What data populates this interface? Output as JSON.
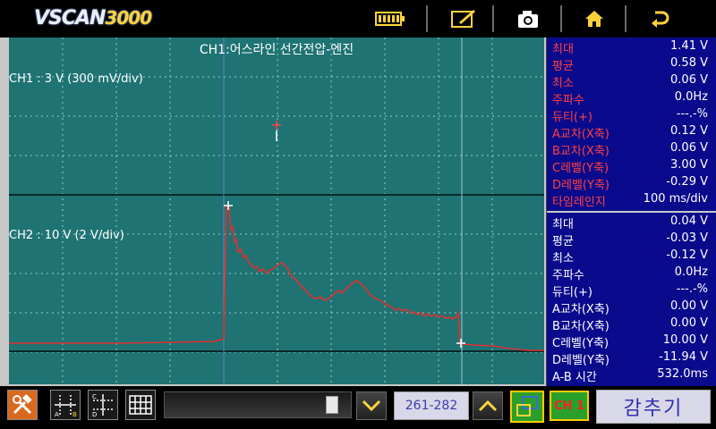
{
  "topbar": {
    "logo_main": "VSCAN",
    "logo_num": "3000",
    "icons": [
      "battery-icon",
      "edit-icon",
      "camera-icon",
      "home-icon",
      "back-icon"
    ]
  },
  "plot": {
    "title": "CH1:어스라인 선간전압-엔진",
    "ch1_label": "CH1 : 3 V (300 mV/div)",
    "ch2_label": "CH2 : 10 V (2 V/div)"
  },
  "panel": {
    "ch1": [
      {
        "label": "최대",
        "value": "1.41 V",
        "color": "red"
      },
      {
        "label": "평균",
        "value": "0.58 V",
        "color": "red"
      },
      {
        "label": "최소",
        "value": "0.06 V",
        "color": "red"
      },
      {
        "label": "주파수",
        "value": "0.0Hz",
        "color": "red"
      },
      {
        "label": "듀티(+)",
        "value": "---.-%",
        "color": "red"
      },
      {
        "label": "A교차(X축)",
        "value": "0.12 V",
        "color": "red"
      },
      {
        "label": "B교차(X축)",
        "value": "0.06 V",
        "color": "red"
      },
      {
        "label": "C레벨(Y축)",
        "value": "3.00 V",
        "color": "red"
      },
      {
        "label": "D레벨(Y축)",
        "value": "-0.29 V",
        "color": "red"
      },
      {
        "label": "타임레인지",
        "value": "100 ms/div",
        "color": "red"
      }
    ],
    "ch2": [
      {
        "label": "최대",
        "value": "0.04 V",
        "color": "white"
      },
      {
        "label": "평균",
        "value": "-0.03 V",
        "color": "white"
      },
      {
        "label": "최소",
        "value": "-0.12 V",
        "color": "white"
      },
      {
        "label": "주파수",
        "value": "0.0Hz",
        "color": "white"
      },
      {
        "label": "듀티(+)",
        "value": "---.-%",
        "color": "white"
      },
      {
        "label": "A교차(X축)",
        "value": "0.00 V",
        "color": "white"
      },
      {
        "label": "B교차(X축)",
        "value": "0.00 V",
        "color": "white"
      },
      {
        "label": "C레벨(Y축)",
        "value": "10.00 V",
        "color": "white"
      },
      {
        "label": "D레벨(Y축)",
        "value": "-11.94 V",
        "color": "white"
      },
      {
        "label": "A-B 시간",
        "value": "532.0ms",
        "color": "white"
      }
    ]
  },
  "bottombar": {
    "range": "261-282",
    "ch_button": "CH 1",
    "hide_button": "감추기",
    "icons": [
      "tools-icon",
      "cursor-ab-icon",
      "cursor-cd-icon",
      "grid-icon",
      "chevron-down-icon",
      "chevron-up-icon",
      "overlay-icon"
    ]
  },
  "colors": {
    "plot_bg": "#1f7373",
    "panel_bg": "#0a0a8c",
    "ch1_color": "#ff4040",
    "trace_color": "#e03030"
  }
}
